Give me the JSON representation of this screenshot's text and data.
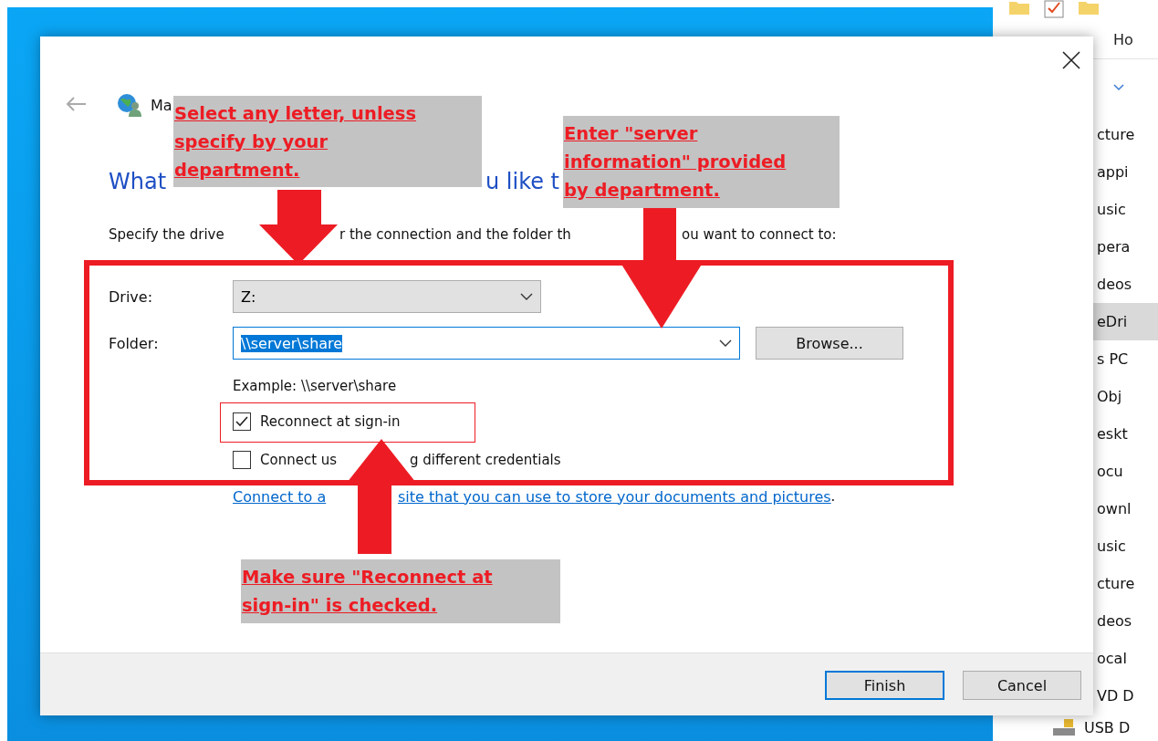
{
  "explorer": {
    "tab": "Ho",
    "items": [
      {
        "label": "cture",
        "selected": false
      },
      {
        "label": "appi",
        "selected": false
      },
      {
        "label": "usic",
        "selected": false
      },
      {
        "label": "pera",
        "selected": false
      },
      {
        "label": "deos",
        "selected": false
      },
      {
        "label": "eDri",
        "selected": true
      },
      {
        "label": "s PC",
        "selected": false
      },
      {
        "label": "Obj",
        "selected": false
      },
      {
        "label": "eskt",
        "selected": false
      },
      {
        "label": "ocu",
        "selected": false
      },
      {
        "label": "ownl",
        "selected": false
      },
      {
        "label": "usic",
        "selected": false
      },
      {
        "label": "cture",
        "selected": false
      },
      {
        "label": "deos",
        "selected": false
      },
      {
        "label": "ocal",
        "selected": false
      },
      {
        "label": "VD D",
        "selected": false
      }
    ],
    "drive_item": "USB D"
  },
  "dialog": {
    "title": "Ma",
    "heading": [
      "What",
      "u like t"
    ],
    "instruction": [
      "Specify the drive ",
      "r the connection and the folder th",
      "ou want to connect to:"
    ],
    "drive": {
      "label": "Drive:",
      "value": "Z:"
    },
    "folder": {
      "label": "Folder:",
      "value": "\\\\server\\share",
      "text_highlighted": true
    },
    "browse": "Browse...",
    "example": "Example: \\\\server\\share",
    "checkboxes": [
      {
        "label": [
          "Reconnect at sign-in"
        ],
        "checked": true
      },
      {
        "label": [
          "Connect us",
          "g different credentials"
        ],
        "checked": false
      }
    ],
    "link": [
      "Connect to a",
      "site that you can use to store your documents and pictures"
    ],
    "link_tail": ".",
    "buttons": [
      {
        "label": "Finish",
        "selected": true
      },
      {
        "label": "Cancel",
        "selected": false
      }
    ]
  },
  "annotations": [
    {
      "lines": [
        "Select any letter, unless",
        "specify by your",
        "department."
      ]
    },
    {
      "lines": [
        "Enter \"server",
        "information\" provided",
        "by department."
      ]
    },
    {
      "lines": [
        "Make sure \"Reconnect at",
        "sign-in\" is checked."
      ]
    }
  ]
}
